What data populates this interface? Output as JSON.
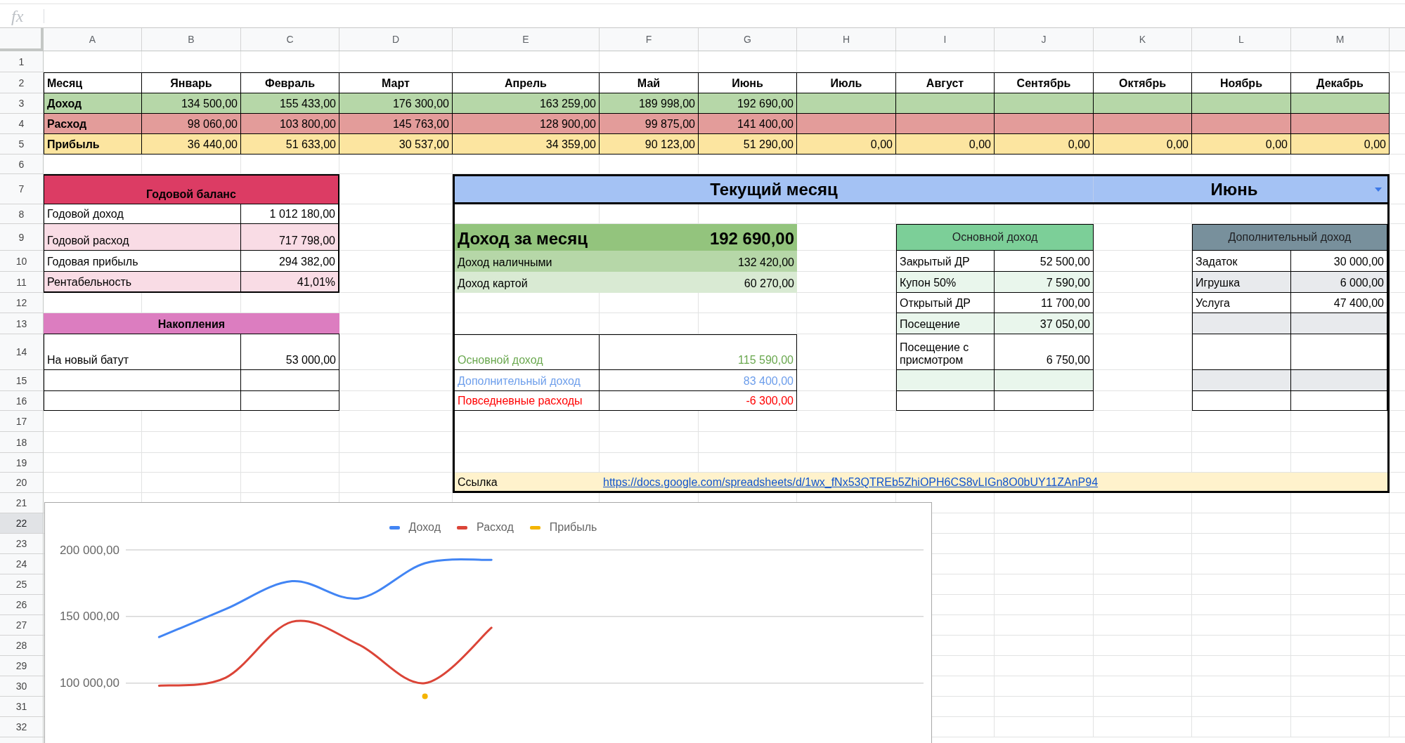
{
  "formula_bar": {
    "icon_label": "fx"
  },
  "column_headers": [
    {
      "label": "A",
      "selected": false
    },
    {
      "label": "B",
      "selected": false
    },
    {
      "label": "C",
      "selected": false
    },
    {
      "label": "D",
      "selected": false
    },
    {
      "label": "E",
      "selected": false
    },
    {
      "label": "F",
      "selected": false
    },
    {
      "label": "G",
      "selected": false
    },
    {
      "label": "H",
      "selected": false
    },
    {
      "label": "I",
      "selected": false
    },
    {
      "label": "J",
      "selected": false
    },
    {
      "label": "K",
      "selected": false
    },
    {
      "label": "L",
      "selected": false
    },
    {
      "label": "M",
      "selected": false
    }
  ],
  "row_headers": [
    {
      "label": "1",
      "selected": false
    },
    {
      "label": "2",
      "selected": false
    },
    {
      "label": "3",
      "selected": false
    },
    {
      "label": "4",
      "selected": false
    },
    {
      "label": "5",
      "selected": false
    },
    {
      "label": "6",
      "selected": false
    },
    {
      "label": "7",
      "selected": false
    },
    {
      "label": "8",
      "selected": false
    },
    {
      "label": "9",
      "selected": false
    },
    {
      "label": "10",
      "selected": false
    },
    {
      "label": "11",
      "selected": false
    },
    {
      "label": "12",
      "selected": false
    },
    {
      "label": "13",
      "selected": false
    },
    {
      "label": "14",
      "selected": false
    },
    {
      "label": "15",
      "selected": false
    },
    {
      "label": "16",
      "selected": false
    },
    {
      "label": "17",
      "selected": false
    },
    {
      "label": "18",
      "selected": false
    },
    {
      "label": "19",
      "selected": false
    },
    {
      "label": "20",
      "selected": false
    },
    {
      "label": "21",
      "selected": false
    },
    {
      "label": "22",
      "selected": true
    },
    {
      "label": "23",
      "selected": false
    },
    {
      "label": "24",
      "selected": false
    },
    {
      "label": "25",
      "selected": false
    },
    {
      "label": "26",
      "selected": false
    },
    {
      "label": "27",
      "selected": false
    },
    {
      "label": "28",
      "selected": false
    },
    {
      "label": "29",
      "selected": false
    },
    {
      "label": "30",
      "selected": false
    },
    {
      "label": "31",
      "selected": false
    },
    {
      "label": "32",
      "selected": false
    }
  ],
  "summary_table": {
    "header": "Месяц",
    "months": [
      "Январь",
      "Февраль",
      "Март",
      "Апрель",
      "Май",
      "Июнь",
      "Июль",
      "Август",
      "Сентябрь",
      "Октябрь",
      "Ноябрь",
      "Декабрь"
    ],
    "rows": [
      {
        "label": "Доход",
        "color": "#b6d7a8",
        "values": [
          "134 500,00",
          "155 433,00",
          "176 300,00",
          "163 259,00",
          "189 998,00",
          "192 690,00"
        ]
      },
      {
        "label": "Расход",
        "color": "#e39c9a",
        "values": [
          "98 060,00",
          "103 800,00",
          "145 763,00",
          "128 900,00",
          "99 875,00",
          "141 400,00"
        ]
      },
      {
        "label": "Прибыль",
        "color": "#fce5a0",
        "values": [
          "36 440,00",
          "51 633,00",
          "30 537,00",
          "34 359,00",
          "90 123,00",
          "51 290,00",
          "0,00",
          "0,00",
          "0,00",
          "0,00",
          "0,00",
          "0,00"
        ]
      }
    ]
  },
  "annual_balance": {
    "title": "Годовой баланс",
    "rows": [
      {
        "label": "Годовой доход",
        "value": "1 012 180,00"
      },
      {
        "label": "Годовой расход",
        "value": "717 798,00"
      },
      {
        "label": "Годовая прибыль",
        "value": "294 382,00"
      },
      {
        "label": "Рентабельность",
        "value": "41,01%"
      }
    ]
  },
  "savings": {
    "title": "Накопления",
    "rows": [
      {
        "label": "На новый батут",
        "value": "53 000,00"
      }
    ]
  },
  "current_month": {
    "title": "Текущий месяц",
    "month_select": {
      "value": "Июнь"
    },
    "income": [
      {
        "kind": "total",
        "label": "Доход за месяц",
        "value": "192 690,00",
        "color": "#93c47d"
      },
      {
        "kind": "line",
        "label": "Доход наличными",
        "value": "132 420,00",
        "color": "#b6d7a8"
      },
      {
        "kind": "line",
        "label": "Доход картой",
        "value": "60 270,00",
        "color": "#d9ead3"
      }
    ],
    "breakdown": [
      {
        "label": "Основной доход",
        "value": "115 590,00",
        "color": "#6aa84f"
      },
      {
        "label": "Дополнительный доход",
        "value": "83 400,00",
        "color": "#6d9eeb"
      },
      {
        "label": "Повседневные расходы",
        "value": "-6 300,00",
        "color": "#ff0000"
      }
    ],
    "main_income": {
      "title": "Основной доход",
      "rows": [
        {
          "label": "Закрытый ДР",
          "value": "52 500,00"
        },
        {
          "label": "Купон 50%",
          "value": "7 590,00"
        },
        {
          "label": "Открытый ДР",
          "value": "11 700,00"
        },
        {
          "label": "Посещение",
          "value": "37 050,00"
        },
        {
          "label": "Посещение с присмотром",
          "value": "6 750,00"
        }
      ]
    },
    "extra_income": {
      "title": "Дополнительный доход",
      "rows": [
        {
          "label": "Задаток",
          "value": "30 000,00"
        },
        {
          "label": "Игрушка",
          "value": "6 000,00"
        },
        {
          "label": "Услуга",
          "value": "47 400,00"
        }
      ]
    },
    "link": {
      "label": "Ссылка",
      "url": "https://docs.google.com/spreadsheets/d/1wx_fNx53QTREb5ZhiOPH6CS8vLIGn8O0bUY11ZAnP94"
    }
  },
  "chart": {
    "chart_data": {
      "type": "line",
      "legend": "top",
      "series": [
        {
          "name": "Доход",
          "color": "#4285f4",
          "values": [
            134500,
            155500,
            176500,
            163500,
            190000,
            192500,
            null,
            null,
            null,
            null,
            null,
            null
          ]
        },
        {
          "name": "Расход",
          "color": "#db4437",
          "values": [
            98000,
            104000,
            146000,
            129000,
            100000,
            141500,
            null,
            null,
            null,
            null,
            null,
            null
          ]
        },
        {
          "name": "Прибыль",
          "color": "#f4b400",
          "marker": "circle",
          "values": [
            null,
            null,
            null,
            null,
            90000,
            null,
            null,
            null,
            null,
            null,
            null,
            null
          ]
        }
      ],
      "ylim": [
        55000,
        200000
      ],
      "yticks": [
        {
          "value": 100000,
          "label": "100 000,00"
        },
        {
          "value": 150000,
          "label": "150 000,00"
        },
        {
          "value": 200000,
          "label": "200 000,00"
        }
      ]
    }
  }
}
